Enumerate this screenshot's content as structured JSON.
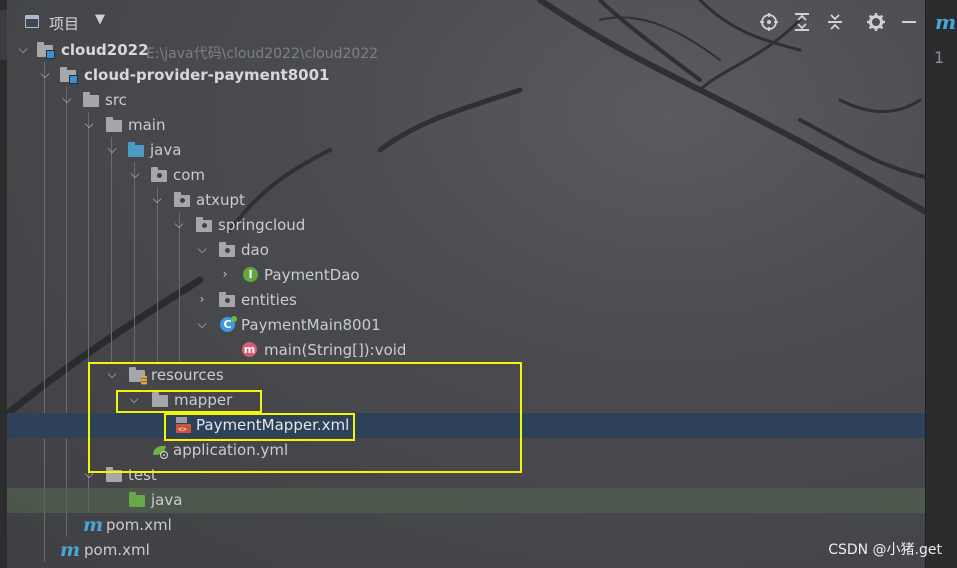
{
  "header": {
    "title": "项目",
    "dropdown_icon": "caret-down-icon",
    "tools": [
      "target-icon",
      "expand-all-icon",
      "collapse-all-icon",
      "gear-icon",
      "minimize-icon"
    ]
  },
  "editor": {
    "tab_icon_glyph": "m",
    "line_number": "1"
  },
  "tree": {
    "root": {
      "label": "cloud2022",
      "path": "E:\\java代码\\cloud2022\\cloud2022"
    },
    "module": {
      "label": "cloud-provider-payment8001"
    },
    "src": "src",
    "main": "main",
    "java": "java",
    "com": "com",
    "atxupt": "atxupt",
    "springcloud": "springcloud",
    "dao": "dao",
    "payment_dao": "PaymentDao",
    "entities": "entities",
    "payment_main": "PaymentMain8001",
    "main_method": "main(String[]):void",
    "resources": "resources",
    "mapper": "mapper",
    "payment_mapper_xml": "PaymentMapper.xml",
    "application_yml": "application.yml",
    "test": "test",
    "test_java": "java",
    "module_pom": "pom.xml",
    "root_pom": "pom.xml",
    "interface_badge": "I",
    "class_badge": "C",
    "method_badge": "m",
    "maven_badge": "m"
  },
  "colors": {
    "selection": "#2d4158",
    "highlight_box": "#f4f409",
    "source_folder": "#4c9bc2",
    "test_folder": "#69a84a"
  },
  "watermark": "CSDN @小猪.get"
}
